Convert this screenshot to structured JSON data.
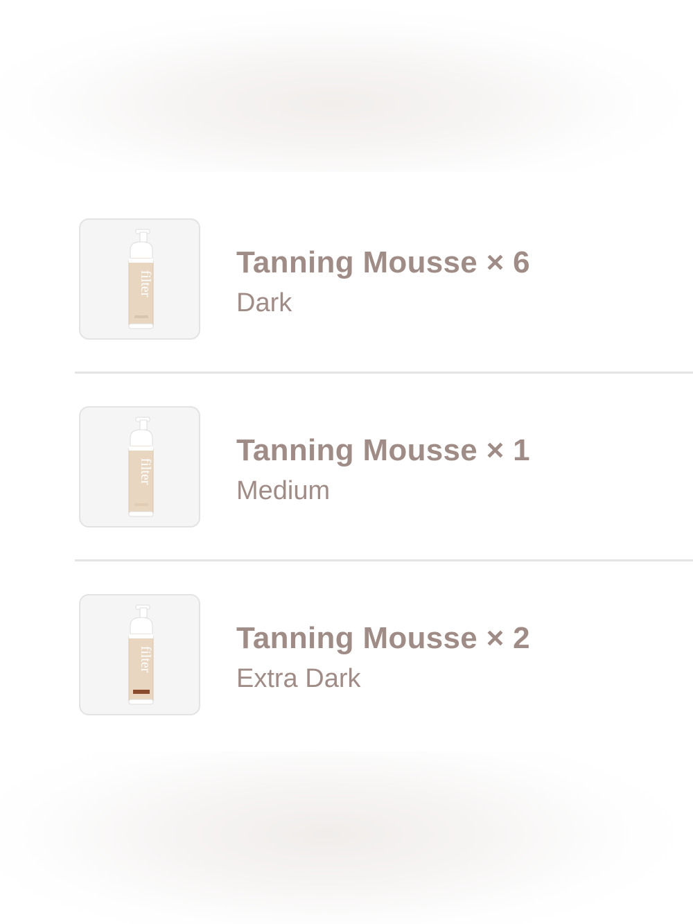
{
  "order_items": [
    {
      "title": "Tanning Mousse × 6",
      "variant": "Dark",
      "brand": "filter",
      "band_color": "#d9c4ad"
    },
    {
      "title": "Tanning Mousse × 1",
      "variant": "Medium",
      "brand": "filter",
      "band_color": "#e2cdb4"
    },
    {
      "title": "Tanning Mousse × 2",
      "variant": "Extra Dark",
      "brand": "filter",
      "band_color": "#8a4a2e"
    }
  ],
  "colors": {
    "text": "#a08c87",
    "divider": "#e6e4e3",
    "thumb_bg": "#f5f5f5",
    "bottle_label": "#e8d6c1"
  }
}
